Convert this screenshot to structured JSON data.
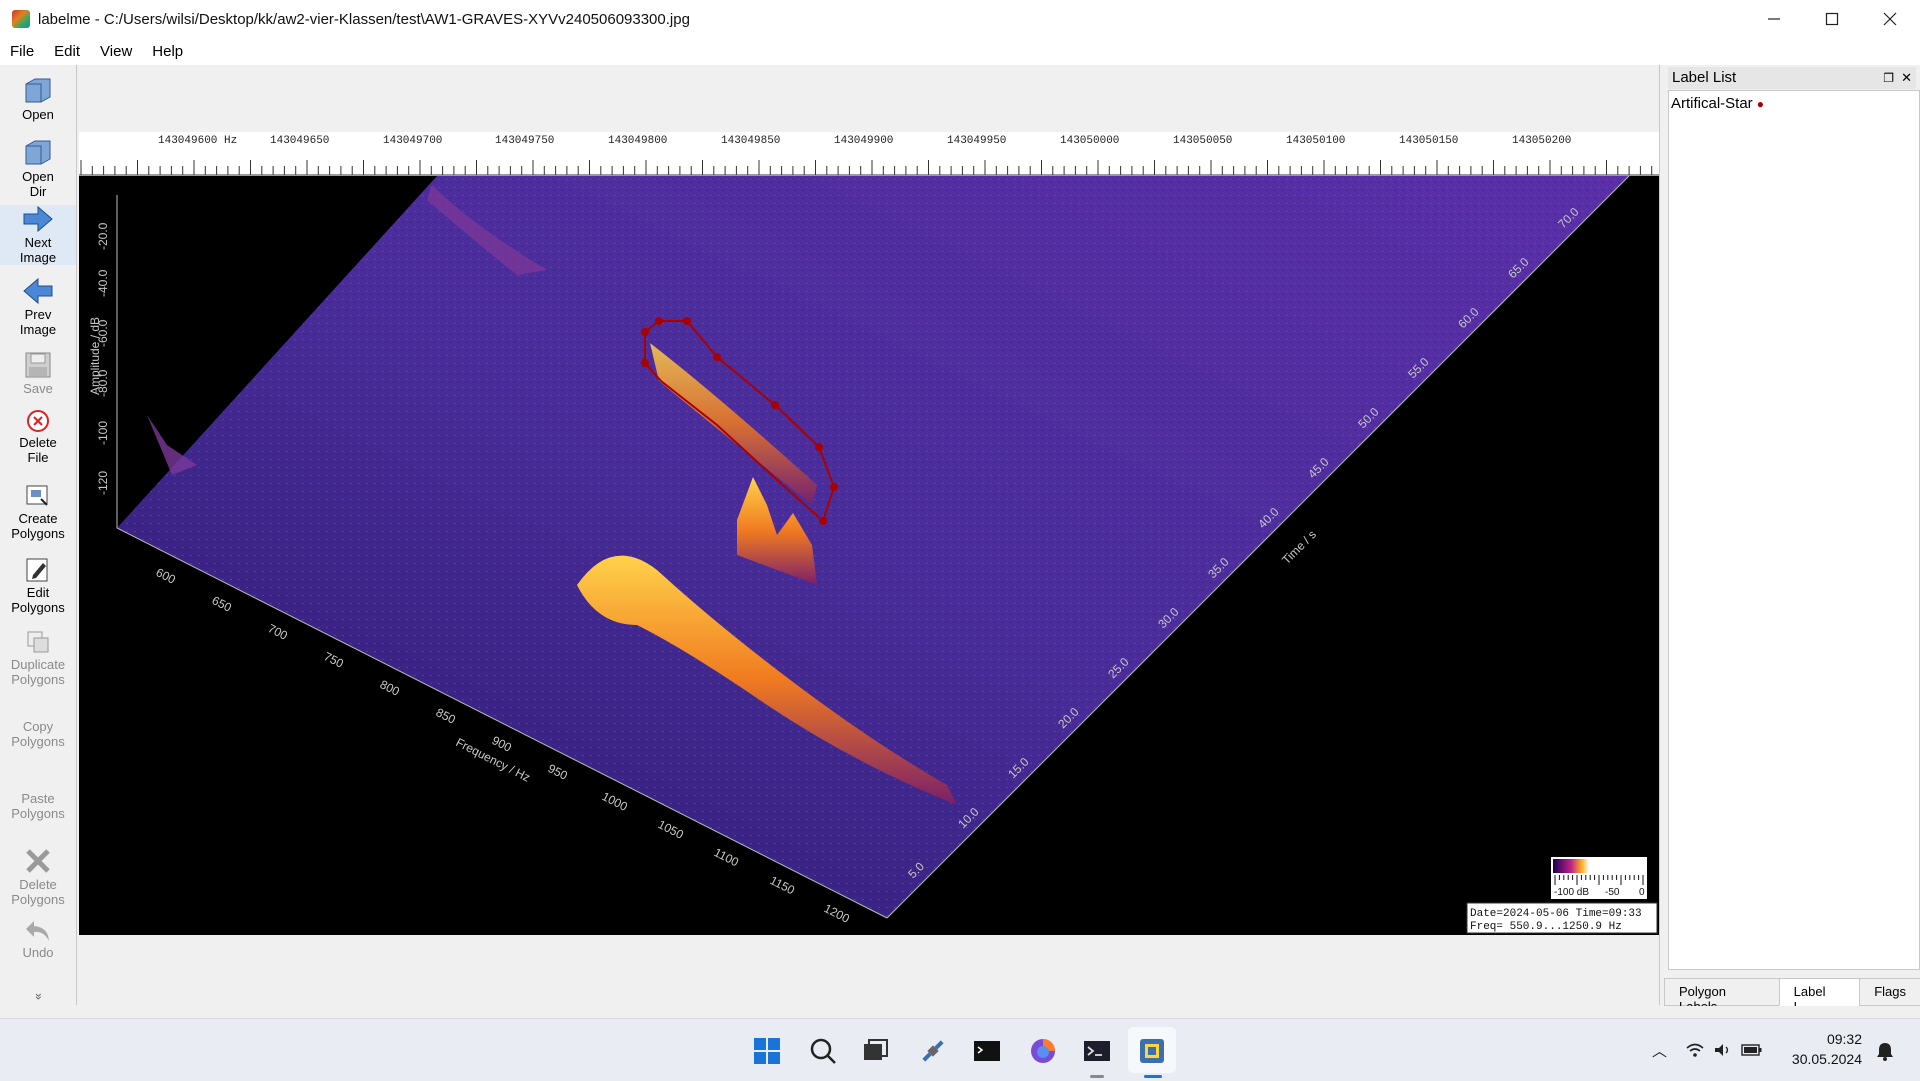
{
  "window": {
    "title": "labelme - C:/Users/wilsi/Desktop/kk/aw2-vier-Klassen/test\\AW1-GRAVES-XYVv240506093300.jpg",
    "controls": [
      "minimize-icon",
      "maximize-icon",
      "close-icon"
    ]
  },
  "menu": [
    "File",
    "Edit",
    "View",
    "Help"
  ],
  "toolbar": {
    "open": "Open",
    "open_dir_1": "Open",
    "open_dir_2": "Dir",
    "next_1": "Next",
    "next_2": "Image",
    "prev_1": "Prev",
    "prev_2": "Image",
    "save": "Save",
    "delete_file_1": "Delete",
    "delete_file_2": "File",
    "create_1": "Create",
    "create_2": "Polygons",
    "edit_1": "Edit",
    "edit_2": "Polygons",
    "duplicate_1": "Duplicate",
    "duplicate_2": "Polygons",
    "copy_1": "Copy",
    "copy_2": "Polygons",
    "paste_1": "Paste",
    "paste_2": "Polygons",
    "delete_poly_1": "Delete",
    "delete_poly_2": "Polygons",
    "undo": "Undo",
    "more": "»"
  },
  "image": {
    "top_axis_labels": [
      "143049600 Hz",
      "143049650",
      "143049700",
      "143049750",
      "143049800",
      "143049850",
      "143049900",
      "143049950",
      "143050000",
      "143050050",
      "143050100",
      "143050150",
      "143050200"
    ],
    "amplitude_label": "Amplitude / dB",
    "amplitude_ticks": [
      "-20.0",
      "-40.0",
      "-60.0",
      "-80.0",
      "-100",
      "-120"
    ],
    "frequency_label": "Frequency / Hz",
    "frequency_ticks": [
      "600",
      "650",
      "700",
      "750",
      "800",
      "850",
      "900",
      "950",
      "1000",
      "1050",
      "1100",
      "1150",
      "1200"
    ],
    "time_label": "Time / s",
    "time_ticks": [
      "5.0",
      "10.0",
      "15.0",
      "20.0",
      "25.0",
      "30.0",
      "35.0",
      "40.0",
      "45.0",
      "50.0",
      "55.0",
      "60.0",
      "65.0",
      "70.0"
    ],
    "colorbar_ticks": [
      "-100 dB",
      "-50",
      "0"
    ],
    "info_line1": "Date=2024-05-06 Time=09:33",
    "info_line2": "Freq= 550.9...1250.9 Hz"
  },
  "dock": {
    "title": "Label List",
    "items": [
      {
        "label": "Artifical-Star",
        "color": "#aa0000"
      }
    ],
    "tabs": [
      "Polygon Labels",
      "Label L...",
      "Flags"
    ]
  },
  "taskbar": {
    "icons": [
      "windows-start-icon",
      "search-icon",
      "task-view-icon",
      "satellite-app-icon",
      "terminal-icon",
      "firefox-icon",
      "console-icon",
      "python-labelme-icon"
    ],
    "time": "09:32",
    "date": "30.05.2024"
  }
}
